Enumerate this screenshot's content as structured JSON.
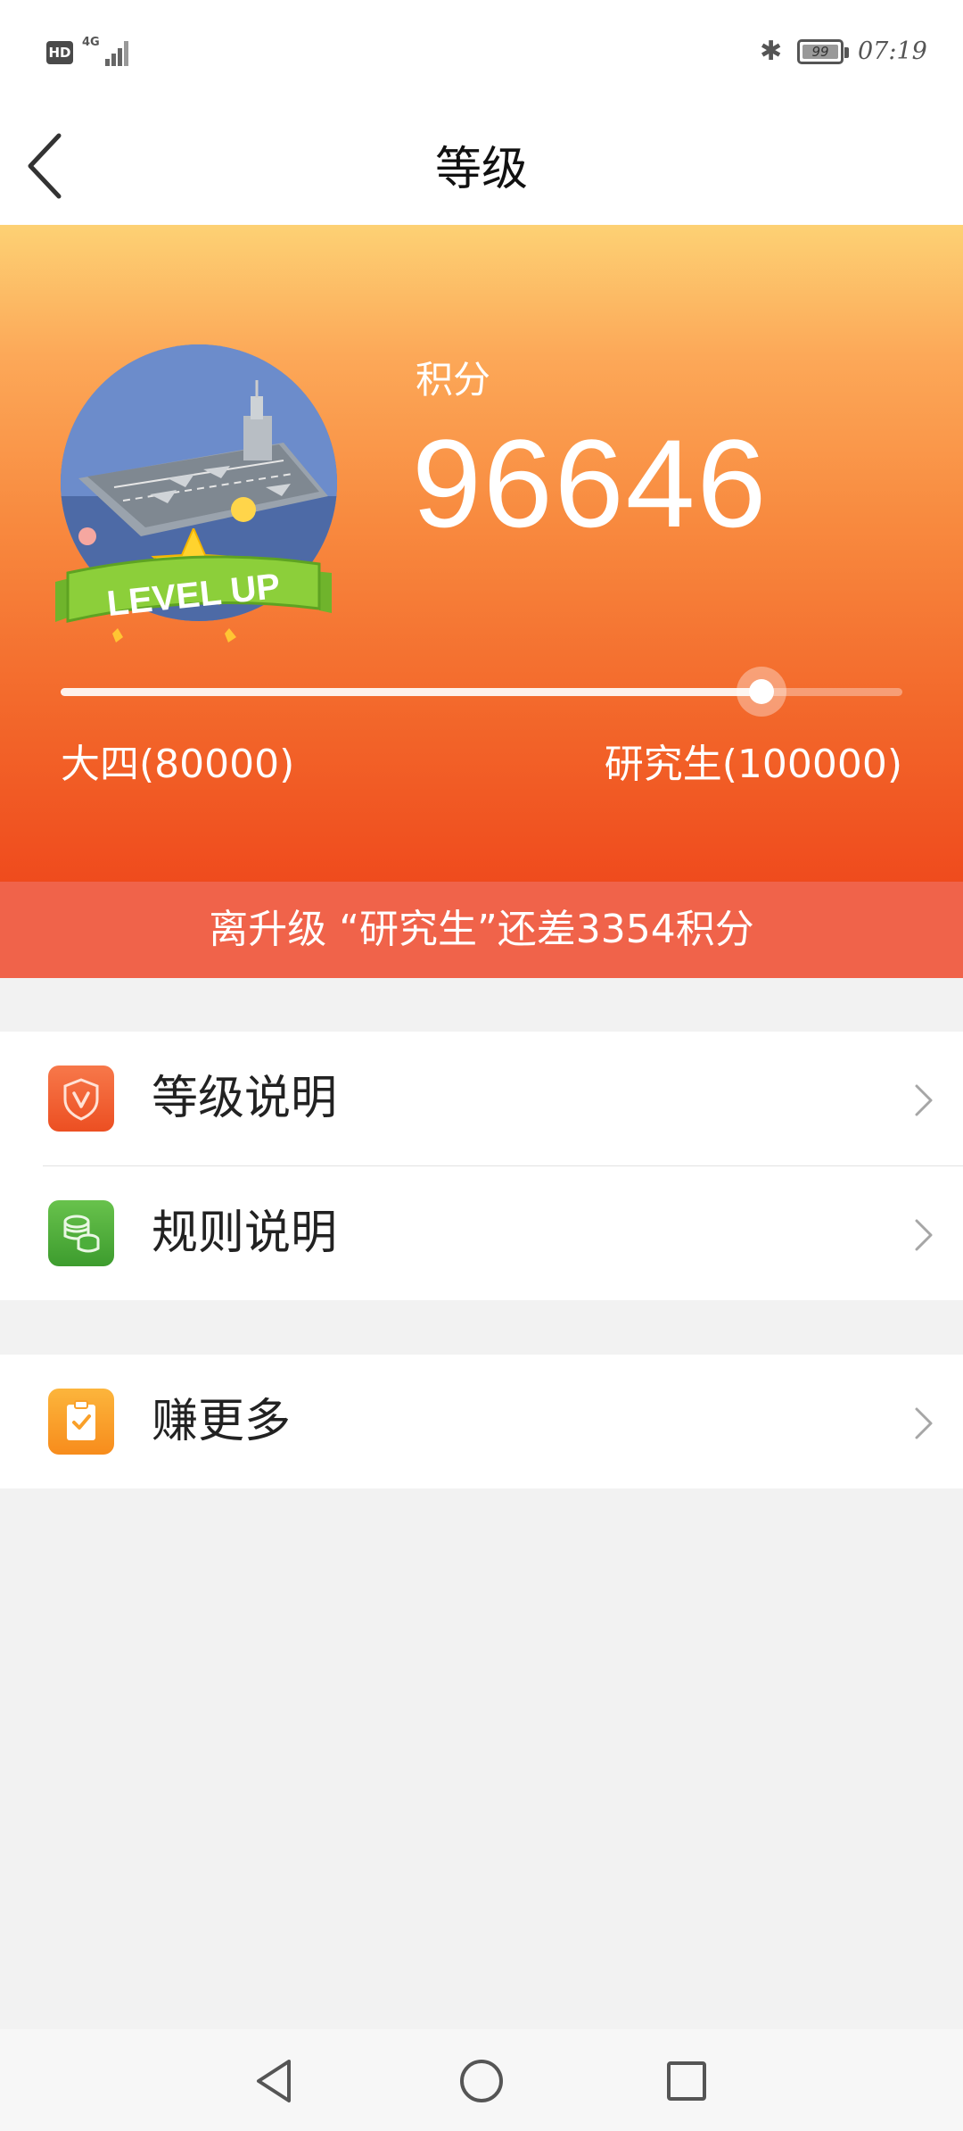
{
  "status_bar": {
    "hd_label": "HD",
    "network_label": "4G",
    "battery_level": "99",
    "time": "07:19"
  },
  "header": {
    "title": "等级",
    "back_icon": "chevron-left-icon"
  },
  "hero": {
    "points_label": "积分",
    "points_value": "96646",
    "level_up_text": "LEVEL UP",
    "current_level_label": "大四(80000)",
    "next_level_label": "研究生(100000)",
    "progress_fraction": 0.8323
  },
  "banner": {
    "remaining_text": "离升级 “研究生”还差3354积分"
  },
  "menu": {
    "group1": [
      {
        "label": "等级说明",
        "icon": "shield-v-icon",
        "color": "#f05a2a"
      },
      {
        "label": "规则说明",
        "icon": "coins-stack-icon",
        "color": "#4cae3a"
      }
    ],
    "group2": [
      {
        "label": "赚更多",
        "icon": "clipboard-check-icon",
        "color": "#f9a02a"
      }
    ]
  },
  "system_nav": {
    "back": "triangle-back-icon",
    "home": "circle-home-icon",
    "recents": "square-recents-icon"
  },
  "colors": {
    "hero_top": "#fdd174",
    "hero_bottom": "#ef4b1d",
    "banner": "#f0634a",
    "background": "#f2f2f2"
  }
}
